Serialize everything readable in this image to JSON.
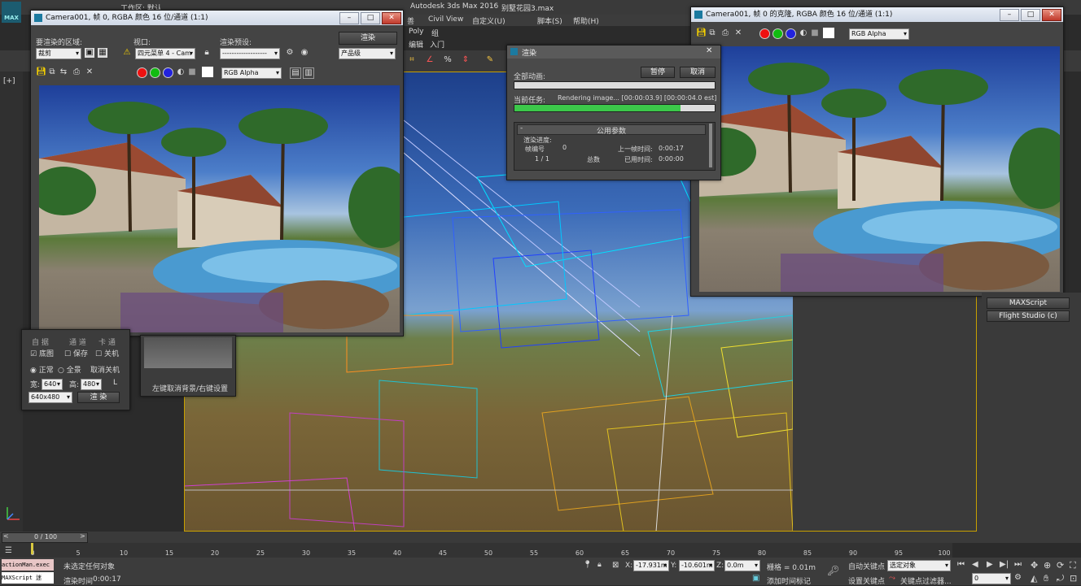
{
  "app": {
    "title": "Autodesk 3ds Max 2016",
    "file": "别墅花园3.max",
    "workspace": "工作区: 默认",
    "logo": "MAX"
  },
  "menu": [
    "Civil View",
    "自定义(U)",
    "脚本(S)",
    "帮助(H)"
  ],
  "menu_partial": "善",
  "ribbon_tabs": [
    "Poly",
    "组"
  ],
  "ribbon_tabs2": [
    "编辑",
    "入门"
  ],
  "viewport_label": "[+]",
  "frame_window_left": {
    "title": "Camera001, 帧 0, RGBA 颜色 16 位/通道 (1:1)",
    "area_label": "要渲染的区域:",
    "area_value": "裁剪",
    "viewport_label": "视口:",
    "viewport_value": "四元菜单 4 - Cam",
    "preset_label": "渲染预设:",
    "preset_value": "-------------------",
    "render_button": "渲染",
    "quality_value": "产品级",
    "channel_value": "RGB Alpha"
  },
  "frame_window_right": {
    "title": "Camera001, 帧 0 的克隆, RGBA 颜色 16 位/通道 (1:1)",
    "channel_value": "RGB Alpha"
  },
  "render_dialog": {
    "title": "渲染",
    "overall_label": "全部动画:",
    "pause_button": "暂停",
    "cancel_button": "取消",
    "current_label": "当前任务:",
    "current_value": "Rendering image... [00:00:03.9] [00:00:04.0 est]",
    "progress_fraction": 0.83,
    "rollout_title": "公用参数",
    "progress_section": "渲染进度:",
    "frame_label": "帧编号",
    "frame_value": "0",
    "last_frame_label": "上一帧时间:",
    "last_frame_value": "0:00:17",
    "count_value": "1 / 1",
    "total_label": "总数",
    "elapsed_label": "已用时间:",
    "elapsed_value": "0:00:00"
  },
  "left_panel": {
    "row1": [
      "自 据",
      "通 道",
      "卡 通"
    ],
    "row2": [
      "底图",
      "保存",
      "关机"
    ],
    "normal": "正常",
    "full": "全景",
    "cancel_shutdown": "取消关机",
    "width_label": "宽:",
    "width_value": "640",
    "height_label": "高:",
    "height_value": "480",
    "lock_label": "L",
    "size_value": "640x480",
    "render_label": "渲 染"
  },
  "background_panel": {
    "label": "左键取消背景/右键设置"
  },
  "command_panel": {
    "items": [
      "MAXScript",
      "Flight Studio (c)"
    ]
  },
  "timeline": {
    "counter": "0 / 100",
    "ticks": [
      "0",
      "5",
      "10",
      "15",
      "20",
      "25",
      "30",
      "35",
      "40",
      "45",
      "50",
      "55",
      "60",
      "65",
      "70",
      "75",
      "80",
      "85",
      "90",
      "95",
      "100"
    ]
  },
  "status": {
    "script_line1": "actionMan.exec",
    "script_line2": "MAXScript 迷",
    "message": "未选定任何对象",
    "render_time_label": "渲染时间",
    "render_time_value": "0:00:17",
    "x_label": "X:",
    "x_value": "-17.931m",
    "y_label": "Y:",
    "y_value": "-10.601m",
    "z_label": "Z:",
    "z_value": "0.0m",
    "grid_label": "栅格 = 0.01m",
    "auto_key": "自动关键点",
    "selected": "选定对象",
    "set_key": "设置关键点",
    "key_filter": "关键点过滤器...",
    "add_time_tag": "添加时间标记",
    "frame_value": "0"
  },
  "colors": {
    "progress_green": "#3cc84a",
    "panel": "#444444",
    "titlebar": "#dbe3ef"
  }
}
